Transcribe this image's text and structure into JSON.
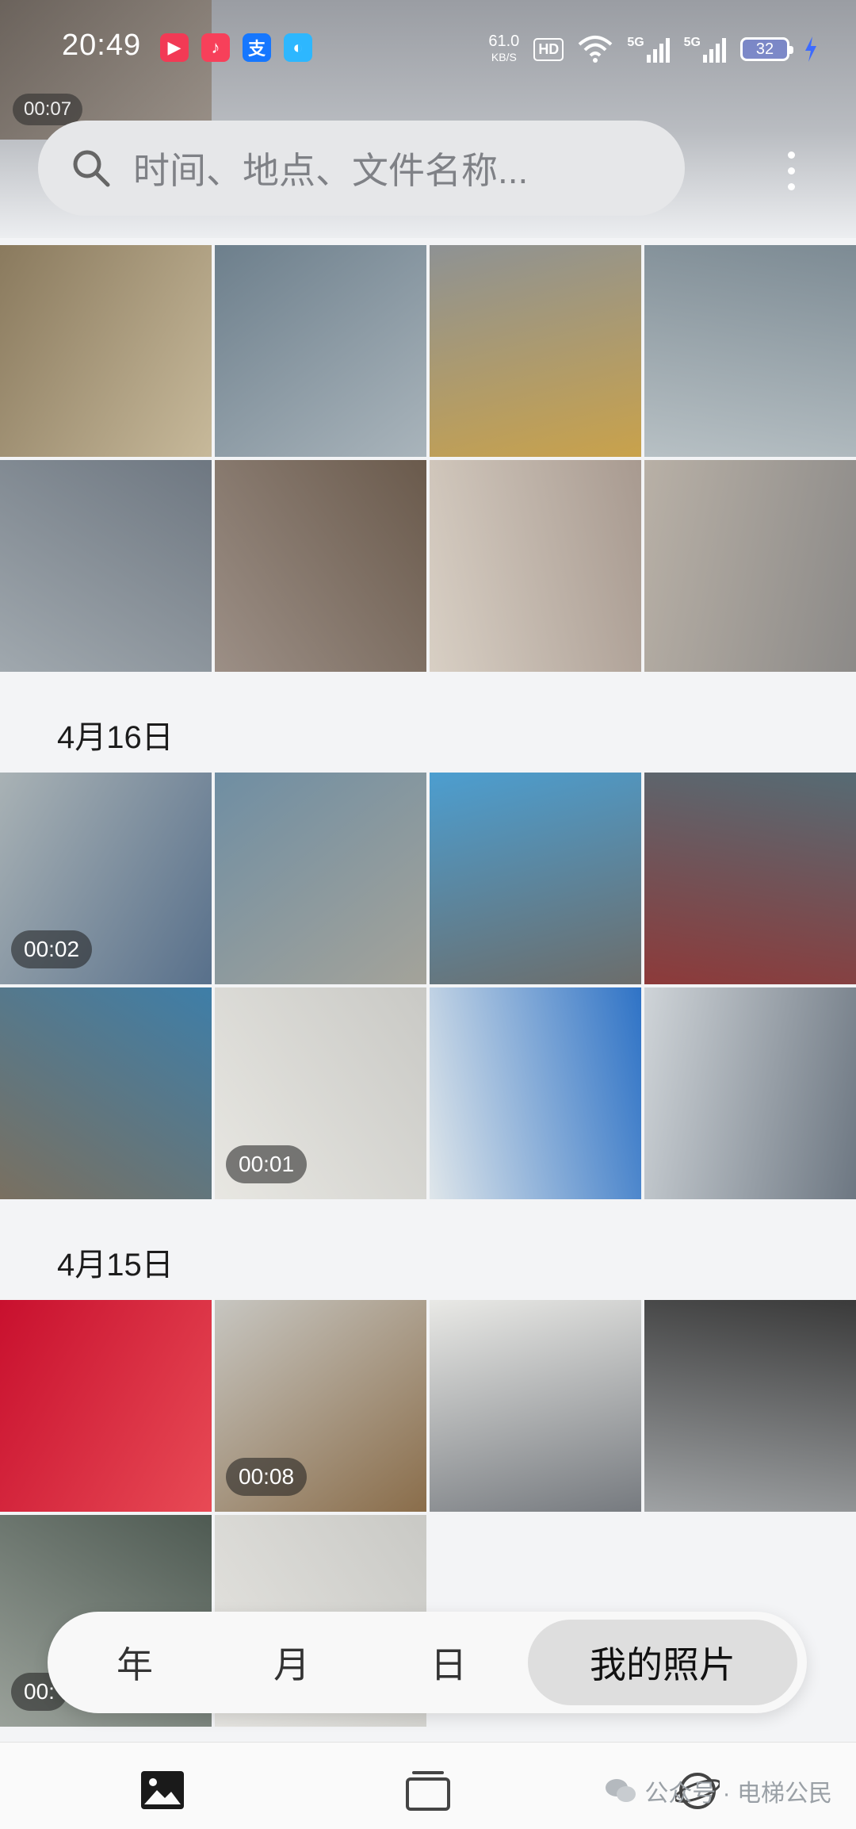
{
  "status_bar": {
    "time": "20:49",
    "net_speed_value": "61.0",
    "net_speed_unit": "KB/S",
    "hd_label": "HD",
    "battery_level": "32",
    "signal_1": "5G",
    "signal_2": "5G",
    "app_badges": [
      {
        "icon": "video-app-icon",
        "glyph": "▶",
        "color": "#f23a55"
      },
      {
        "icon": "music-app-icon",
        "glyph": "♪",
        "color": "#f7405a"
      },
      {
        "icon": "alipay-icon",
        "glyph": "支",
        "color": "#1677ff"
      },
      {
        "icon": "cloud-app-icon",
        "glyph": "◐",
        "color": "#2db7ff"
      }
    ]
  },
  "top_clip_duration": "00:07",
  "search": {
    "placeholder": "时间、地点、文件名称..."
  },
  "sections": [
    {
      "date": "",
      "photos": [
        {
          "duration": "",
          "colors": [
            "#8a7a5e",
            "#c7b99a"
          ]
        },
        {
          "duration": "",
          "colors": [
            "#6d7f8c",
            "#a9b4bb"
          ]
        },
        {
          "duration": "",
          "colors": [
            "#8e9294",
            "#c9a24b"
          ]
        },
        {
          "duration": "",
          "colors": [
            "#7d8b94",
            "#b7c0c4"
          ]
        },
        {
          "duration": "",
          "colors": [
            "#6e7781",
            "#a0a8ae"
          ]
        },
        {
          "duration": "",
          "colors": [
            "#6a5a4c",
            "#9c8f86"
          ]
        },
        {
          "duration": "",
          "colors": [
            "#a89a90",
            "#d8cfc4"
          ]
        },
        {
          "duration": "",
          "colors": [
            "#8c8a88",
            "#b8b0a6"
          ]
        }
      ]
    },
    {
      "date": "4月16日",
      "photos": [
        {
          "duration": "00:02",
          "colors": [
            "#a9b2b5",
            "#58708b"
          ]
        },
        {
          "duration": "",
          "colors": [
            "#6f8ea3",
            "#a4a39a"
          ]
        },
        {
          "duration": "",
          "colors": [
            "#4c9ed0",
            "#6c6d6b"
          ]
        },
        {
          "duration": "",
          "colors": [
            "#566b74",
            "#8d3a3a"
          ]
        },
        {
          "duration": "",
          "colors": [
            "#3e7ea8",
            "#7a7060"
          ]
        },
        {
          "duration": "00:01",
          "colors": [
            "#c9c9c5",
            "#e8e7e2"
          ]
        },
        {
          "duration": "",
          "colors": [
            "#2f73c6",
            "#dfe6ea"
          ]
        },
        {
          "duration": "",
          "colors": [
            "#6d7782",
            "#cfd4d8"
          ]
        }
      ]
    },
    {
      "date": "4月15日",
      "photos": [
        {
          "duration": "",
          "colors": [
            "#c8102e",
            "#e84a55"
          ]
        },
        {
          "duration": "00:08",
          "colors": [
            "#c7c6c1",
            "#8a6d4a"
          ]
        },
        {
          "duration": "",
          "colors": [
            "#e9e9e6",
            "#767a7f"
          ]
        },
        {
          "duration": "",
          "colors": [
            "#3a3a3a",
            "#9fa2a4"
          ]
        },
        {
          "duration": "",
          "colors": [
            "#4e5a52",
            "#9aa19a"
          ]
        },
        {
          "duration": "",
          "colors": [
            "#c9c9c5",
            "#e6e5e1"
          ]
        }
      ]
    }
  ],
  "partial_duration": "00:",
  "view_switcher": {
    "items": [
      {
        "label": "年",
        "active": false
      },
      {
        "label": "月",
        "active": false
      },
      {
        "label": "日",
        "active": false
      },
      {
        "label": "我的照片",
        "active": true
      }
    ]
  },
  "bottom_nav": {
    "items": [
      {
        "icon": "photos-icon",
        "label": "照片"
      },
      {
        "icon": "albums-icon",
        "label": "图集"
      },
      {
        "icon": "discover-icon",
        "label": "发现"
      }
    ]
  },
  "watermark": {
    "text": "公众号 · 电梯公民"
  },
  "colors": {
    "accent": "#1a1a1a",
    "background": "#f3f4f6"
  }
}
